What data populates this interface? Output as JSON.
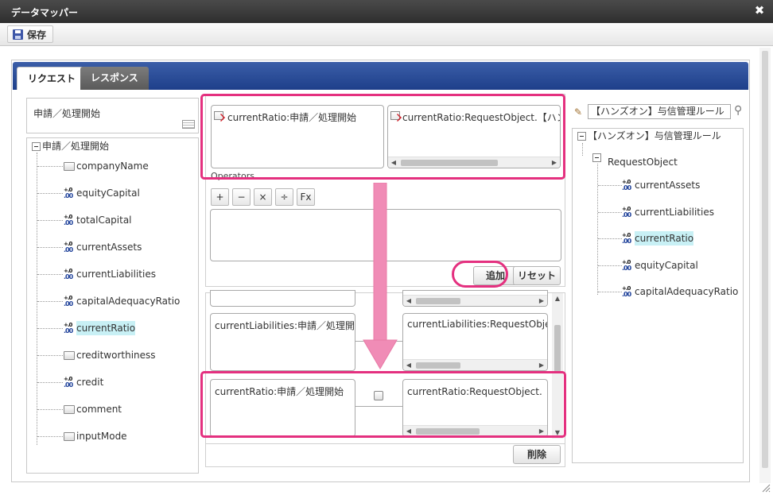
{
  "window": {
    "title": "データマッパー",
    "close_icon": "✖"
  },
  "toolbar": {
    "save_label": "保存"
  },
  "tabs": {
    "request": "リクエスト",
    "response": "レスポンス"
  },
  "left": {
    "selected_name": "申請／処理開始",
    "root": "申請／処理開始",
    "items": [
      {
        "label": "companyName",
        "type": "string"
      },
      {
        "label": "equityCapital",
        "type": "number"
      },
      {
        "label": "totalCapital",
        "type": "number"
      },
      {
        "label": "currentAssets",
        "type": "number"
      },
      {
        "label": "currentLiabilities",
        "type": "number"
      },
      {
        "label": "capitalAdequacyRatio",
        "type": "number"
      },
      {
        "label": "currentRatio",
        "type": "number",
        "selected": true
      },
      {
        "label": "creditworthiness",
        "type": "string"
      },
      {
        "label": "credit",
        "type": "number"
      },
      {
        "label": "comment",
        "type": "string"
      },
      {
        "label": "inputMode",
        "type": "string"
      }
    ]
  },
  "middle": {
    "source_field": "currentRatio:申請／処理開始",
    "target_field": "currentRatio:RequestObject.【ハンズオ",
    "operators_label": "Operators",
    "operators": [
      "+",
      "−",
      "×",
      "÷",
      "Fx"
    ],
    "add_button": "追加",
    "reset_button": "リセット",
    "delete_button": "削除",
    "mappings": [
      {
        "source": "currentLiabilities:申請／処理開始",
        "target": "currentLiabilities:RequestObject."
      },
      {
        "source": "currentRatio:申請／処理開始",
        "target": "currentRatio:RequestObject.【ハ"
      }
    ]
  },
  "right": {
    "search_value": "【ハンズオン】与信管理ルール",
    "root": "【ハンズオン】与信管理ルール",
    "object": "RequestObject",
    "items": [
      {
        "label": "currentAssets",
        "selected": false
      },
      {
        "label": "currentLiabilities",
        "selected": false
      },
      {
        "label": "currentRatio",
        "selected": true
      },
      {
        "label": "equityCapital",
        "selected": false
      },
      {
        "label": "capitalAdequacyRatio",
        "selected": false
      }
    ]
  },
  "colors": {
    "highlight": "#e4307f",
    "arrow": "#f08cb6",
    "tabbar": "#2a4d98",
    "selection": "#c8f0f5"
  }
}
